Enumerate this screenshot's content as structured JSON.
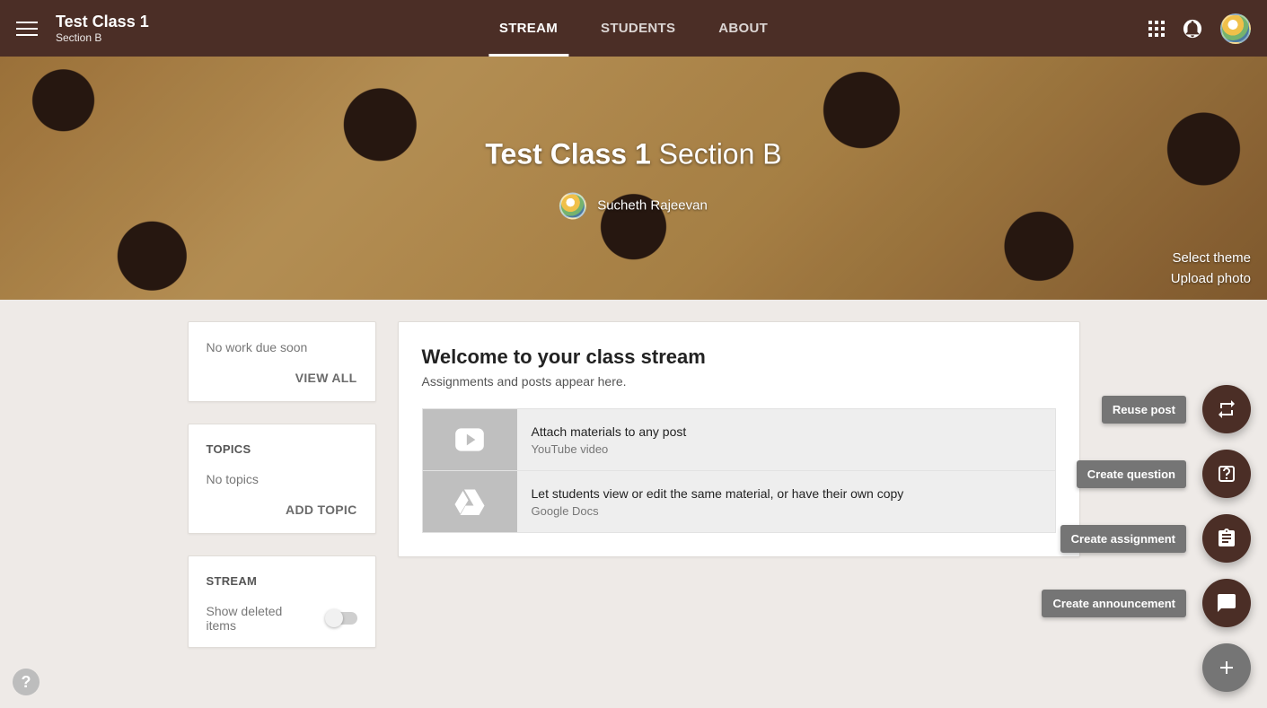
{
  "header": {
    "class_name": "Test Class 1",
    "section": "Section B",
    "tabs": [
      "STREAM",
      "STUDENTS",
      "ABOUT"
    ],
    "active_tab": 0
  },
  "banner": {
    "title_bold": "Test Class 1",
    "title_light": "Section B",
    "teacher": "Sucheth Rajeevan",
    "link_theme": "Select theme",
    "link_upload": "Upload photo"
  },
  "sidebar": {
    "upcoming": {
      "empty_text": "No work due soon",
      "view_all": "VIEW ALL"
    },
    "topics": {
      "heading": "TOPICS",
      "empty_text": "No topics",
      "add_topic": "ADD TOPIC"
    },
    "stream_settings": {
      "heading": "STREAM",
      "show_deleted": "Show deleted items"
    }
  },
  "stream": {
    "welcome_title": "Welcome to your class stream",
    "welcome_sub": "Assignments and posts appear here.",
    "tips": [
      {
        "title": "Attach materials to any post",
        "subtitle": "YouTube video",
        "icon": "play"
      },
      {
        "title": "Let students view or edit the same material, or have their own copy",
        "subtitle": "Google Docs",
        "icon": "drive"
      }
    ]
  },
  "fab": {
    "reuse": "Reuse post",
    "question": "Create question",
    "assignment": "Create assignment",
    "announcement": "Create announcement"
  }
}
